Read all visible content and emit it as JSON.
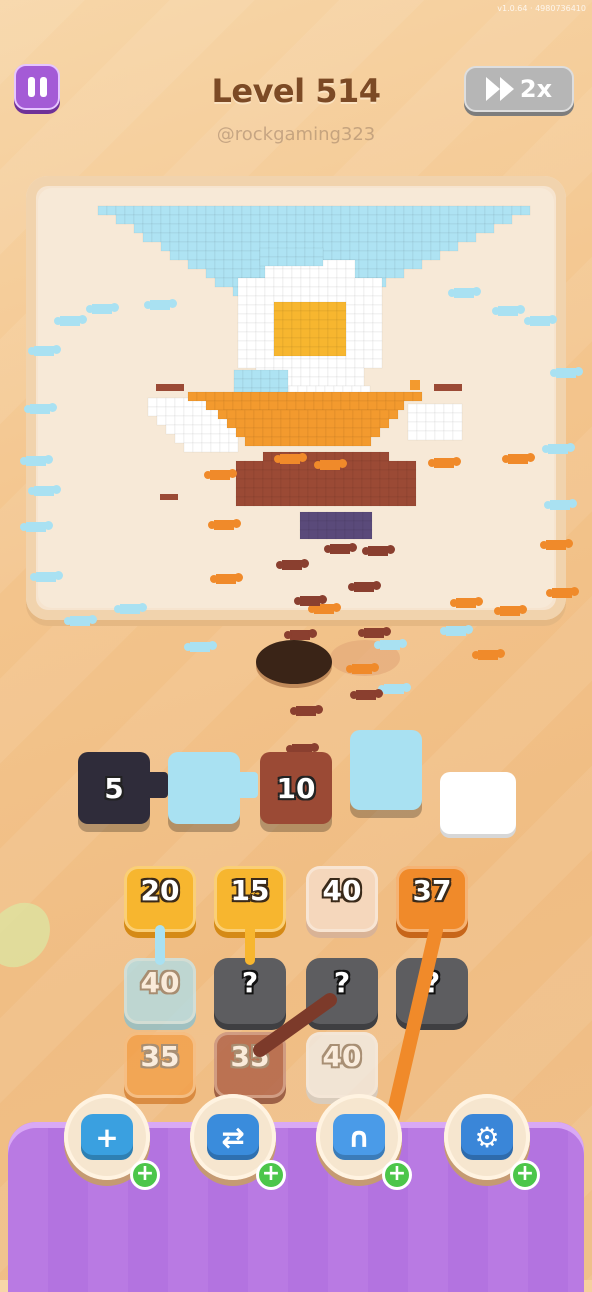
{
  "version": "v1.0.64 · 4980736410",
  "header": {
    "level_title": "Level 514",
    "watermark": "@rockgaming323",
    "speed_label": "2x"
  },
  "colors": {
    "sky": "#aee3f3",
    "white": "#ffffff",
    "orange": "#f39a2e",
    "brown": "#9b4a35",
    "dark": "#2f2c3a",
    "cream": "#f4dcc4",
    "ant_blue": "#a9e1f2",
    "ant_orange": "#f08a2a",
    "ant_brown": "#8a3f2f"
  },
  "queue": [
    {
      "count": "5",
      "color": "#2f2c3a",
      "kind": "cannon"
    },
    {
      "count": "",
      "color": "#a9e1f2",
      "kind": "cannon-empty"
    },
    {
      "count": "10",
      "color": "#9b4a35",
      "kind": "block"
    },
    {
      "count": "",
      "color": "#a9e1f2",
      "kind": "block-tall"
    },
    {
      "count": "",
      "color": "#ffffff",
      "kind": "empty-slot"
    }
  ],
  "grid": [
    [
      {
        "value": "20",
        "color": "#f7b62f",
        "shade": "#d58a16"
      },
      {
        "value": "15",
        "color": "#f7b62f",
        "shade": "#d58a16"
      },
      {
        "value": "40",
        "color": "#f5d7bc",
        "shade": "#d9b396"
      },
      {
        "value": "37",
        "color": "#f08a2a",
        "shade": "#c7661a"
      }
    ],
    [
      {
        "value": "40",
        "color": "#a9e1f2",
        "shade": "#7fc0d6",
        "dim": true
      },
      {
        "value": "?",
        "mystery": true
      },
      {
        "value": "?",
        "mystery": true
      },
      {
        "value": "?",
        "mystery": true
      }
    ],
    [
      {
        "value": "35",
        "color": "#f39a3e",
        "shade": "#d07524",
        "dim": true
      },
      {
        "value": "35",
        "color": "#a5523d",
        "shade": "#7c3a2a",
        "dim": true
      },
      {
        "value": "40",
        "color": "#f2f2f2",
        "shade": "#d0d0d0",
        "dim": true
      }
    ]
  ],
  "boosters": [
    {
      "name": "add-slot-booster",
      "icon": "box-plus-icon"
    },
    {
      "name": "shuffle-booster",
      "icon": "swap-arrows-icon"
    },
    {
      "name": "magnet-booster",
      "icon": "magnet-icon"
    },
    {
      "name": "unlock-booster",
      "icon": "gear-lock-icon"
    }
  ]
}
